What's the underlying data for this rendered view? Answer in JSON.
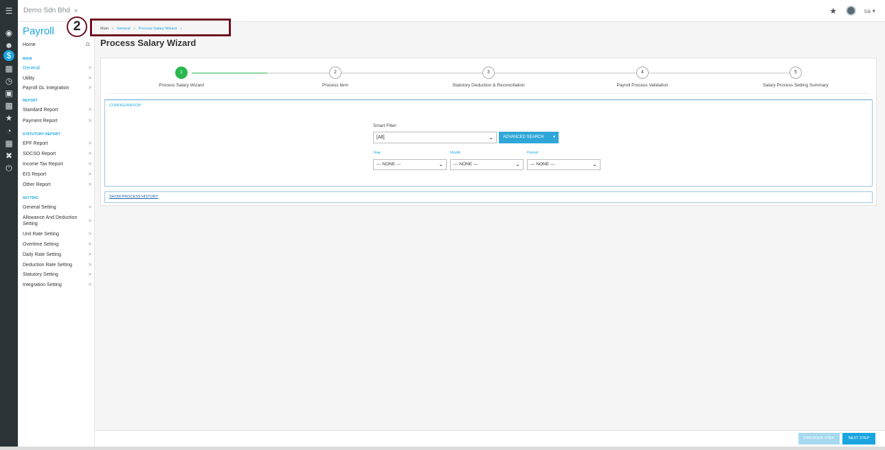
{
  "topbar": {
    "company": "Demo Sdn Bhd",
    "company_chevron": "»",
    "user": "sa",
    "user_caret": "▾"
  },
  "sidebar": {
    "module_title": "Payroll",
    "home": "Home",
    "sections": [
      {
        "title": "MAIN",
        "items": [
          {
            "label": "General",
            "active": true
          },
          {
            "label": "Utility"
          },
          {
            "label": "Payroll GL Integration"
          }
        ]
      },
      {
        "title": "REPORT",
        "items": [
          {
            "label": "Standard Report"
          },
          {
            "label": "Payment Report"
          }
        ]
      },
      {
        "title": "STATUTORY REPORT",
        "items": [
          {
            "label": "EPF Report"
          },
          {
            "label": "SOCSO Report"
          },
          {
            "label": "Income Tax Report"
          },
          {
            "label": "EIS Report"
          },
          {
            "label": "Other Report"
          }
        ]
      },
      {
        "title": "SETTING",
        "items": [
          {
            "label": "General Setting"
          },
          {
            "label": "Allowance And Deduction Setting"
          },
          {
            "label": "Unit Rate Setting"
          },
          {
            "label": "Overtime Setting"
          },
          {
            "label": "Daily Rate Setting"
          },
          {
            "label": "Deduction Rate Setting"
          },
          {
            "label": "Statutory Setting"
          },
          {
            "label": "Integration Setting"
          }
        ]
      }
    ],
    "chevron": ">"
  },
  "annotation": {
    "number": "2"
  },
  "breadcrumb": {
    "root": "Main",
    "items": [
      "General",
      "Process Salary Wizard"
    ],
    "separator": "»"
  },
  "page_title": "Process Salary Wizard",
  "wizard": {
    "current_step": 1,
    "steps": [
      {
        "number": "1",
        "label": "Process Salary Wizard"
      },
      {
        "number": "2",
        "label": "Process Item"
      },
      {
        "number": "3",
        "label": "Statutory Deduction & Reconciliation"
      },
      {
        "number": "4",
        "label": "Payroll Process Validation"
      },
      {
        "number": "5",
        "label": "Salary Process Setting Summary"
      }
    ]
  },
  "config": {
    "title": "CONFIGURATION",
    "smart_filter_label": "Smart Filter:",
    "smart_filter_value": "[All]",
    "advanced_search": "ADVANCED SEARCH",
    "advanced_caret": "▾",
    "year_label": "Year",
    "year_value": "--- NONE ---",
    "month_label": "Month",
    "month_value": "--- NONE ---",
    "period_label": "Period",
    "period_value": "--- NONE ---"
  },
  "history_link": "SHOW PROCESS HISTORY",
  "footer": {
    "previous": "PREVIOUS STEP",
    "next": "NEXT STEP"
  },
  "icons": {
    "menu": "menu-icon",
    "dashboard": "dashboard-icon",
    "users": "users-icon",
    "payroll": "payroll-icon",
    "calendar": "calendar-icon",
    "clock": "clock-icon",
    "expense": "expense-icon",
    "vehicle": "vehicle-icon",
    "award": "award-icon",
    "report": "report-icon",
    "table": "table-icon",
    "tools": "tools-icon",
    "power": "power-icon"
  },
  "colors": {
    "accent": "#1ba5e0",
    "step_done": "#2ab84e",
    "annotation": "#6c0d1e",
    "rail": "#2b3337"
  }
}
